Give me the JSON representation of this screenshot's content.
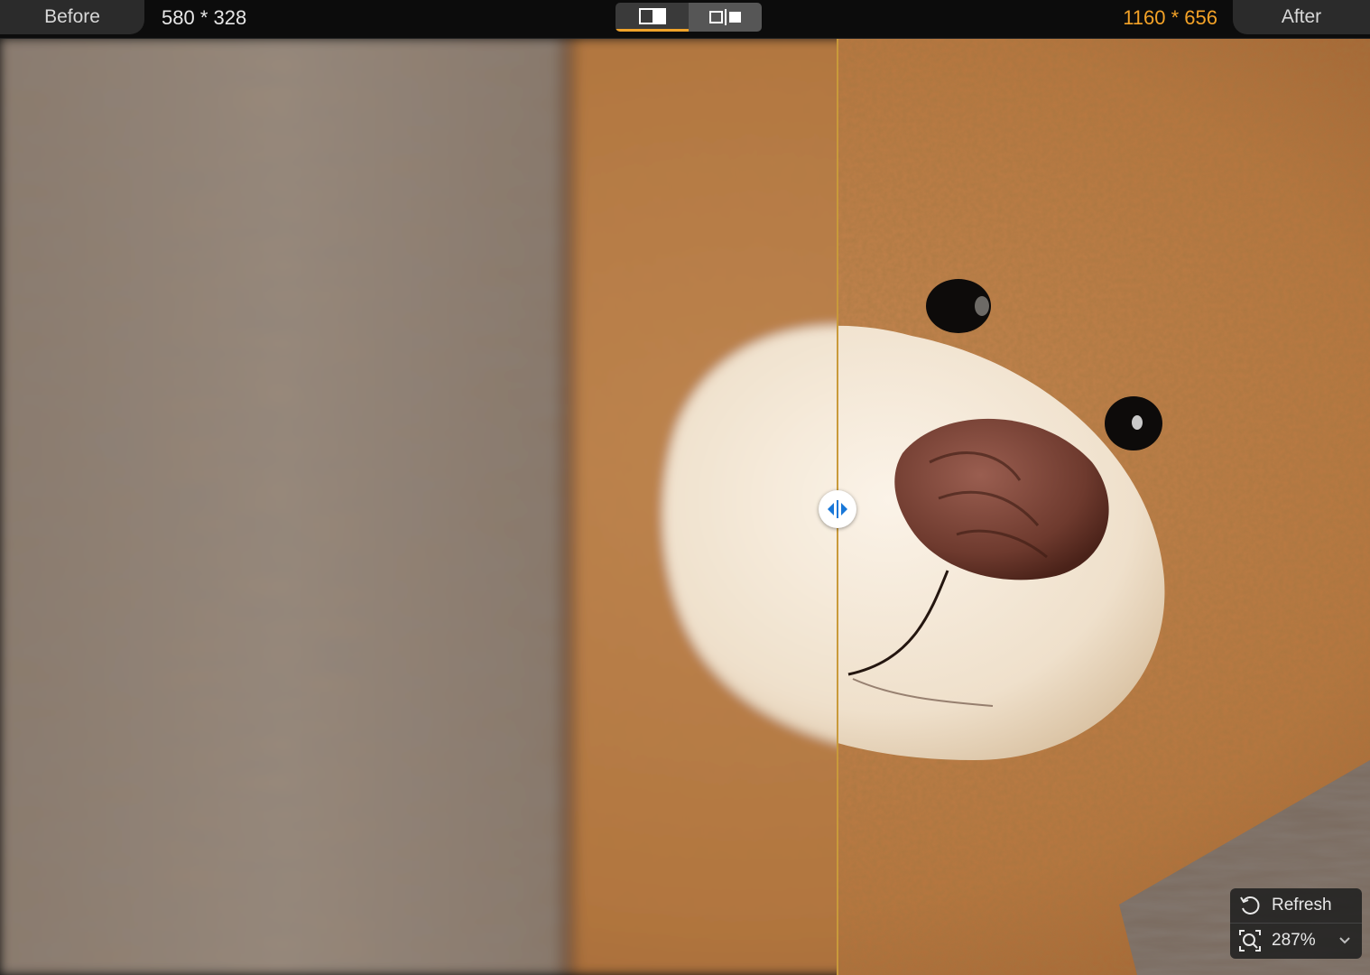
{
  "toolbar": {
    "before_label": "Before",
    "after_label": "After",
    "before_dimensions": "580 * 328",
    "after_dimensions": "1160 * 656",
    "view_modes": [
      {
        "name": "split-view",
        "active": true
      },
      {
        "name": "side-by-side-view",
        "active": false
      }
    ],
    "accent_color": "#f3a227"
  },
  "controls": {
    "refresh_label": "Refresh",
    "zoom_level": "287%"
  },
  "icons": {
    "refresh": "refresh-icon",
    "zoom": "zoom-icon",
    "chevron": "chevron-down-icon",
    "divider": "split-handle-icon"
  }
}
